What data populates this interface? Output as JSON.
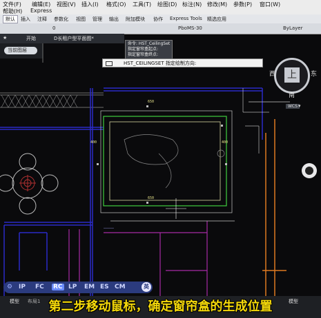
{
  "menubar": {
    "items_row1": [
      "文件(F)",
      "编辑(E)",
      "视图(V)",
      "插入(I)",
      "格式(O)",
      "工具(T)",
      "绘图(D)",
      "标注(N)",
      "修改(M)",
      "参数(P)",
      "窗口(W)"
    ],
    "items_row2": [
      "帮助(H)",
      "Express"
    ]
  },
  "ribbon_tabs": [
    "默认",
    "插入",
    "注释",
    "参数化",
    "视图",
    "管理",
    "输出",
    "附加模块",
    "协作",
    "Express Tools",
    "精选应用"
  ],
  "toolstrip": {
    "layer_value": "0",
    "plotstyle": "PboMS-30",
    "linetype": "ByLayer"
  },
  "tabbar": {
    "start": "开始",
    "file_tab": "D长租户型平面图*"
  },
  "left_dock": {
    "current_layer_label": "当前图层"
  },
  "tooltip": {
    "line1": "命令: HST_CeilingSet",
    "line2": "指定窗帘盒起点:",
    "line3": "指定窗帘盒终点:"
  },
  "command_line": {
    "name": "HST_CEILINGSET",
    "prompt": "指定绘制方向:"
  },
  "viewcube": {
    "top": "上",
    "west": "西",
    "east": "东",
    "south": "南",
    "wcs": "WCS"
  },
  "dims": {
    "d400": "400",
    "d650": "650"
  },
  "snap_modes": [
    "IP",
    "FC",
    "RC",
    "LP",
    "EM",
    "ES",
    "CM"
  ],
  "snap_selected": "RC",
  "snap_lang": "英",
  "status": {
    "model": "模型",
    "layout": "布局1",
    "model_right": "模型"
  },
  "caption": "第二步移动鼠标，确定窗帘盒的生成位置"
}
